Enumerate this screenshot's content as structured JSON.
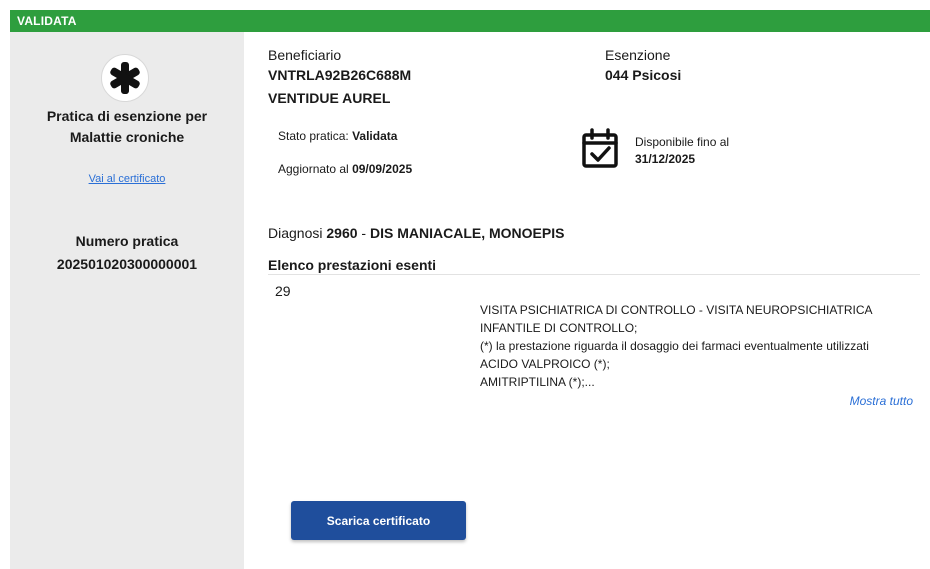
{
  "status": {
    "label": "VALIDATA",
    "color": "#2e9e3e"
  },
  "sidebar": {
    "icon": "asterisk-icon",
    "title_line1": "Pratica di esenzione per",
    "title_line2": "Malattie croniche",
    "certificate_link": "Vai al certificato",
    "numero_label": "Numero pratica",
    "numero_value": "202501020300000001"
  },
  "beneficiary": {
    "label": "Beneficiario",
    "code": "VNTRLA92B26C688M",
    "name": "VENTIDUE AUREL"
  },
  "exemption": {
    "label": "Esenzione",
    "value": "044 Psicosi"
  },
  "practice": {
    "state_label": "Stato pratica:",
    "state_value": "Validata",
    "updated_label": "Aggiornato al",
    "updated_value": "09/09/2025"
  },
  "availability": {
    "icon": "calendar-check-icon",
    "label": "Disponibile fino al",
    "value": "31/12/2025"
  },
  "diagnosis": {
    "label": "Diagnosi",
    "code": "2960",
    "separator": "-",
    "description": "DIS MANIACALE, MONOEPIS"
  },
  "services": {
    "title": "Elenco prestazioni esenti",
    "count": "29",
    "lines": [
      "VISITA PSICHIATRICA DI CONTROLLO - VISITA NEUROPSICHIATRICA",
      "INFANTILE DI CONTROLLO;",
      "(*) la prestazione riguarda il dosaggio dei farmaci eventualmente utilizzati",
      "ACIDO VALPROICO (*);",
      "AMITRIPTILINA (*);..."
    ],
    "show_all": "Mostra tutto"
  },
  "actions": {
    "download_label": "Scarica certificato"
  },
  "colors": {
    "accent_blue": "#1f4e9c",
    "link_blue": "#2a6fd6",
    "sidebar_bg": "#ebebeb"
  }
}
